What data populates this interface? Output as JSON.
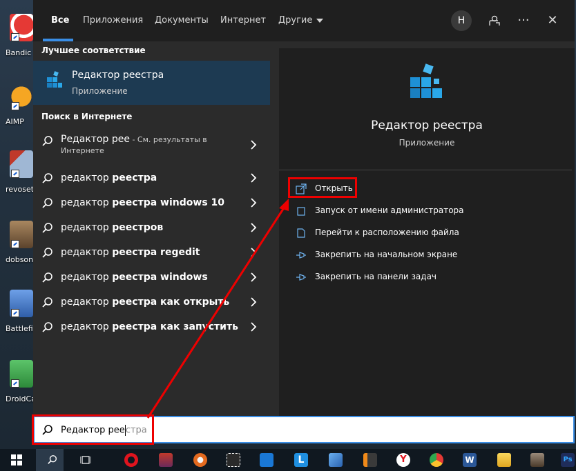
{
  "desktop": {
    "icons": [
      {
        "label": "Bandic",
        "color": "#e53935"
      },
      {
        "label": "AIMP",
        "color": "#f5a623"
      },
      {
        "label": "revosetu",
        "color": "#5a7fa8"
      },
      {
        "label": "dobson",
        "color": "#7a5a3a"
      },
      {
        "label": "Battlefie",
        "color": "#4a7ac8"
      },
      {
        "label": "DroidCa",
        "color": "#3aa14a"
      }
    ]
  },
  "tabs": {
    "all": "Все",
    "apps": "Приложения",
    "documents": "Документы",
    "internet": "Интернет",
    "other": "Другие"
  },
  "header": {
    "avatar_letter": "Н",
    "more": "···",
    "close": "✕"
  },
  "best_match": {
    "heading": "Лучшее соответствие",
    "name": "Редактор реестра",
    "type": "Приложение"
  },
  "web_search": {
    "heading": "Поиск в Интернете",
    "first": {
      "prefix": "Редактор рее",
      "suffix": " - См. результаты в",
      "sub": "Интернете"
    },
    "items": [
      {
        "light": "редактор ",
        "bold": "реестра"
      },
      {
        "light": "редактор ",
        "bold": "реестра windows 10"
      },
      {
        "light": "редактор ",
        "bold": "реестров"
      },
      {
        "light": "редактор ",
        "bold": "реестра regedit"
      },
      {
        "light": "редактор ",
        "bold": "реестра windows"
      },
      {
        "light": "редактор ",
        "bold": "реестра как открыть"
      },
      {
        "light": "редактор ",
        "bold": "реестра как запустить"
      }
    ]
  },
  "detail": {
    "title": "Редактор реестра",
    "type": "Приложение",
    "actions": [
      "Открыть",
      "Запуск от имени администратора",
      "Перейти к расположению файла",
      "Закрепить на начальном экране",
      "Закрепить на панели задач"
    ]
  },
  "search": {
    "typed": "Редактор рее",
    "ghost": "стра"
  },
  "taskbar": {
    "apps": [
      {
        "name": "opera",
        "color": "#e0141e"
      },
      {
        "name": "winrar",
        "color": "#8a3a3a"
      },
      {
        "name": "avast",
        "color": "#e46a1f"
      },
      {
        "name": "cursor-tool",
        "color": "#2a2a2a"
      },
      {
        "name": "mail",
        "color": "#1a78d6"
      },
      {
        "name": "lingoes",
        "color": "#1f8fe0"
      },
      {
        "name": "control-panel",
        "color": "#3a7ac8"
      },
      {
        "name": "sublime",
        "color": "#f08a1a"
      },
      {
        "name": "yandex",
        "color": "#ffffff"
      },
      {
        "name": "chrome",
        "color": "#2fa84f"
      },
      {
        "name": "word",
        "color": "#2b5797"
      },
      {
        "name": "explorer",
        "color": "#f2c230"
      },
      {
        "name": "media",
        "color": "#6a5a4a"
      },
      {
        "name": "photoshop",
        "color": "#1f2d5a"
      }
    ],
    "ps_label": "Ps"
  }
}
